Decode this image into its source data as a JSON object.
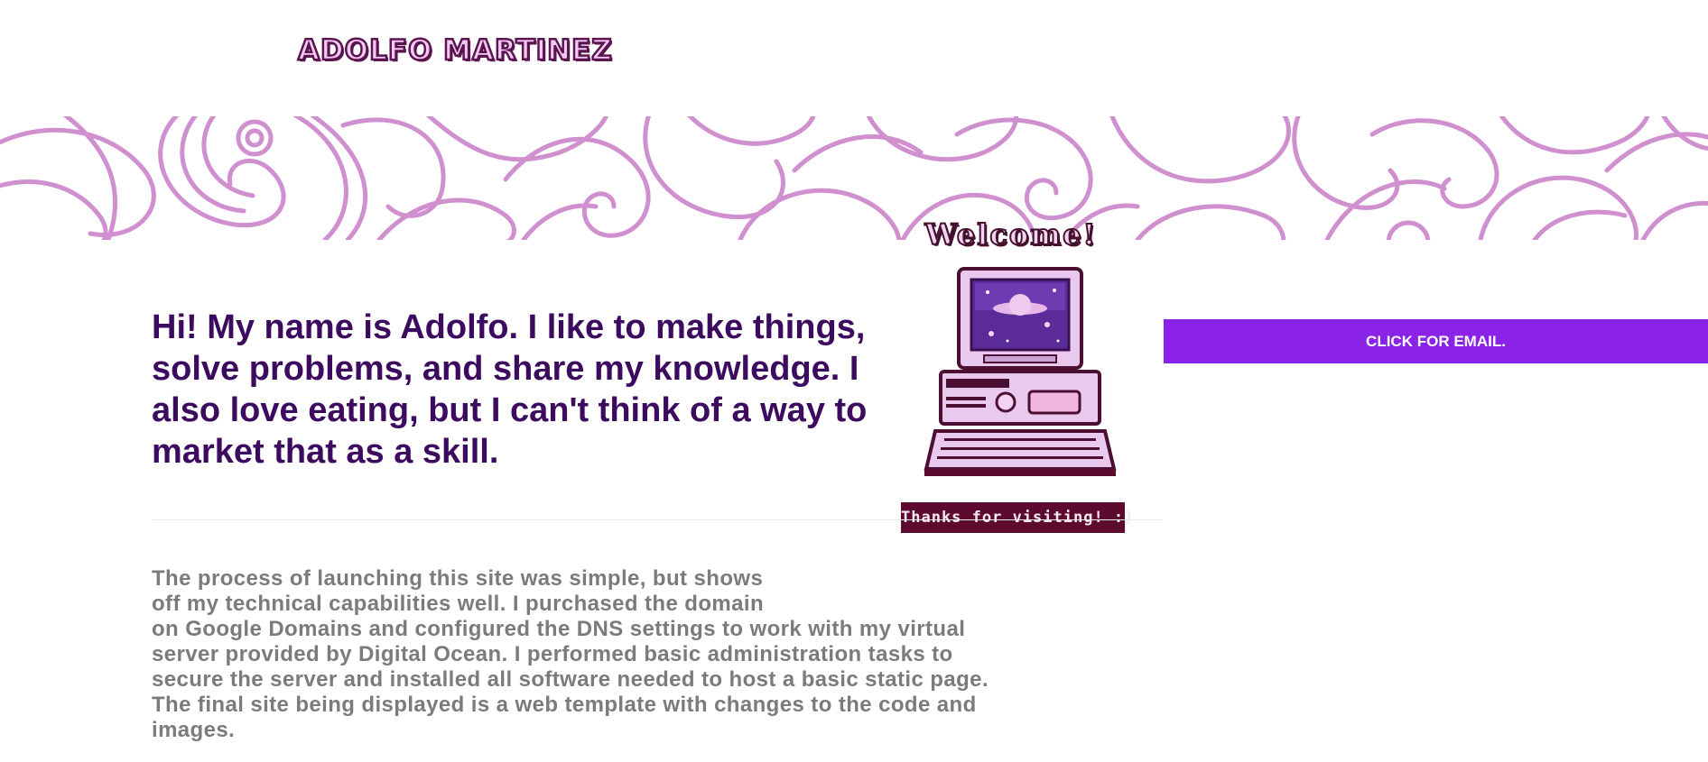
{
  "header": {
    "logo_text": "ADOLFO MARTINEZ"
  },
  "banner": {
    "pattern": "swirl-pattern",
    "color": "#d08fcf"
  },
  "hero": {
    "welcome_text": "Welcome!",
    "illustration": "retro-computer-icon",
    "thanks_text": "Thanks for visiting! :)"
  },
  "intro": {
    "text": "Hi! My name is Adolfo. I like to make things, solve problems, and share my knowledge. I also love eating, but I can't think of a way to market that as a skill."
  },
  "about": {
    "lines": [
      "The process of launching this site was simple, but shows",
      "off my technical capabilities well. I purchased the domain",
      "on Google Domains and configured the DNS settings to work with my virtual",
      "server provided by Digital Ocean. I performed basic administration tasks to",
      "secure the server and installed all software needed to host a basic static page.",
      "The final site being displayed is a web template with changes to the code and",
      "images."
    ]
  },
  "email_button": {
    "label": "CLICK FOR EMAIL."
  },
  "colors": {
    "intro_text": "#3c0b60",
    "body_text": "#7b7b7b",
    "button_bg": "#8a22e8",
    "badge_bg": "#5c0b2e"
  }
}
